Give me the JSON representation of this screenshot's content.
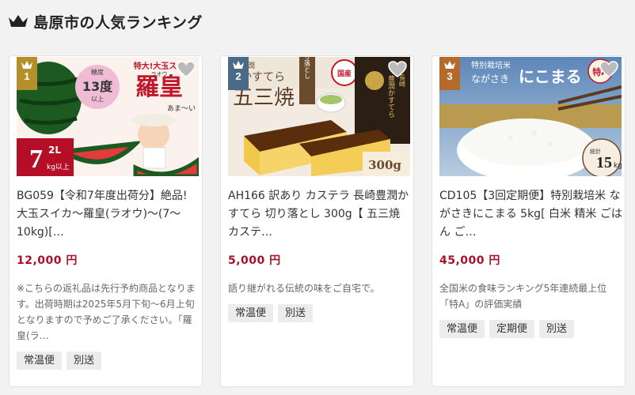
{
  "header": {
    "title": "島原市の人気ランキング",
    "icon": "crown-icon"
  },
  "colors": {
    "rank_badge": "#b39029",
    "price": "#a8112a"
  },
  "cards": [
    {
      "rank": "1",
      "name": "BG059【令和7年度出荷分】絶品! 大玉スイカ～羅皇(ラオウ)～(7～10kg)[…",
      "price": "12,000 円",
      "desc": "※こちらの返礼品は先行予約商品となります。出荷時期は2025年5月下旬～6月上旬となりますので予めご了承ください。「羅皇(ラ…",
      "tags": [
        "常温便",
        "別送"
      ],
      "image": {
        "banner": "特大!大玉スイカ",
        "brand": "羅皇",
        "reading": "ラオウ",
        "sugar_label": "糖度",
        "sugar": "13度",
        "sugar_suffix": "以上",
        "tagline": "あま～い",
        "weight_main": "7",
        "weight_sub": "2L",
        "weight_unit": "kg以上"
      }
    },
    {
      "rank": "2",
      "name": "AH166 訳あり カステラ 長崎豊潤かすてら 切り落とし 300g【 五三焼 カステ…",
      "price": "5,000 円",
      "desc": "語り継がれる伝統の味をご自宅で。",
      "tags": [
        "常温便",
        "別送"
      ],
      "image": {
        "top": "豊潤",
        "reading": "かすてら",
        "main": "五三焼",
        "ribbon": "切り落とし",
        "seal": "国産",
        "pkg": "豊潤かすてら",
        "pkg_side": "長崎",
        "weight": "300g"
      }
    },
    {
      "rank": "3",
      "name": "CD105【3回定期便】特別栽培米 ながさきにこまる 5kg[ 白米 精米 ごはん ご…",
      "price": "45,000 円",
      "desc": "全国米の食味ランキング5年連続最上位「特A」の評価実績",
      "tags": [
        "常温便",
        "定期便",
        "別送"
      ],
      "image": {
        "banner": "特別栽培米",
        "region": "ながさき",
        "brand": "にこまる",
        "rank_label": "特A",
        "total": "総計",
        "weight": "15",
        "unit": "kg"
      }
    }
  ]
}
